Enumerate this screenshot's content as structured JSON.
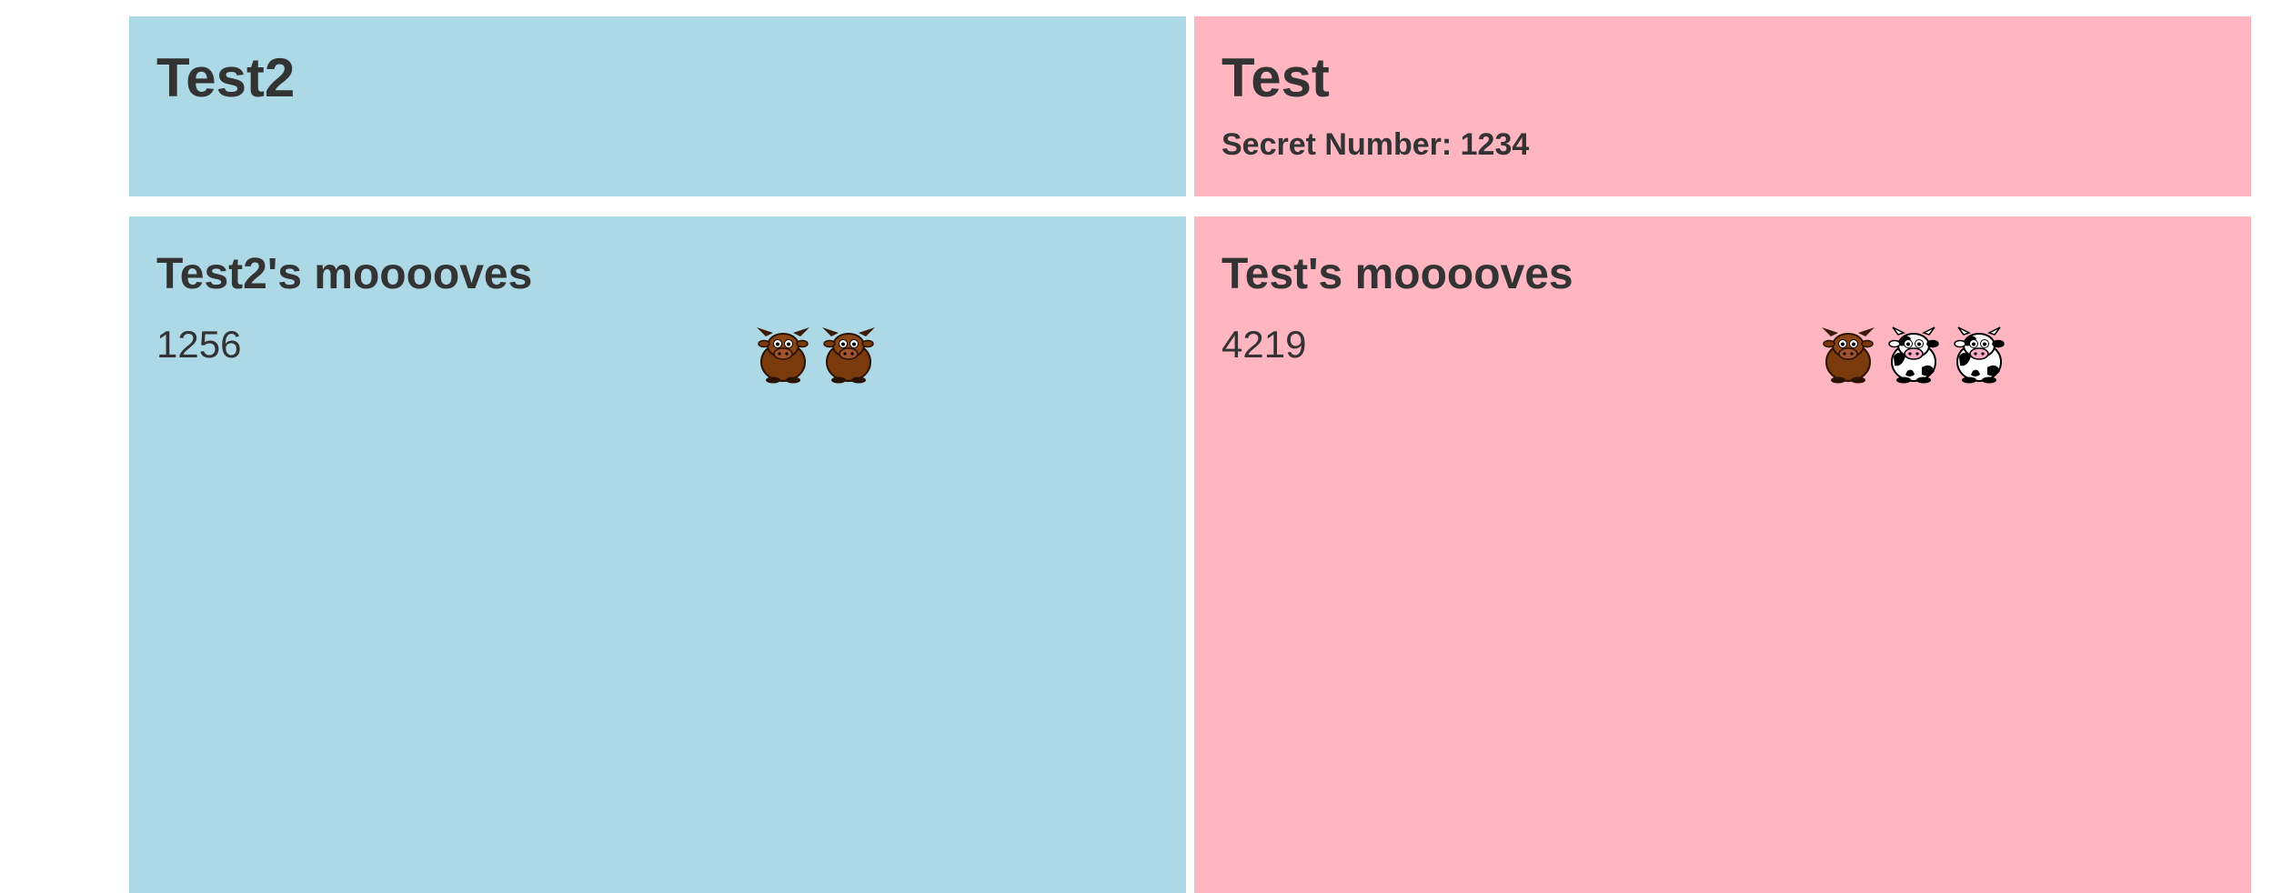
{
  "players": [
    {
      "name": "Test2",
      "moves_title": "Test2's mooooves",
      "guesses": [
        {
          "number": "1256",
          "results": [
            "bull-icon",
            "bull-icon"
          ]
        }
      ]
    },
    {
      "name": "Test",
      "secret_label": "Secret Number: 1234",
      "moves_title": "Test's mooooves",
      "guesses": [
        {
          "number": "4219",
          "results": [
            "bull-icon",
            "cow-icon",
            "cow-icon"
          ]
        }
      ]
    }
  ],
  "colors": {
    "player_blue": "#add8e6",
    "player_pink": "#ffb6c1",
    "text": "#333333"
  }
}
